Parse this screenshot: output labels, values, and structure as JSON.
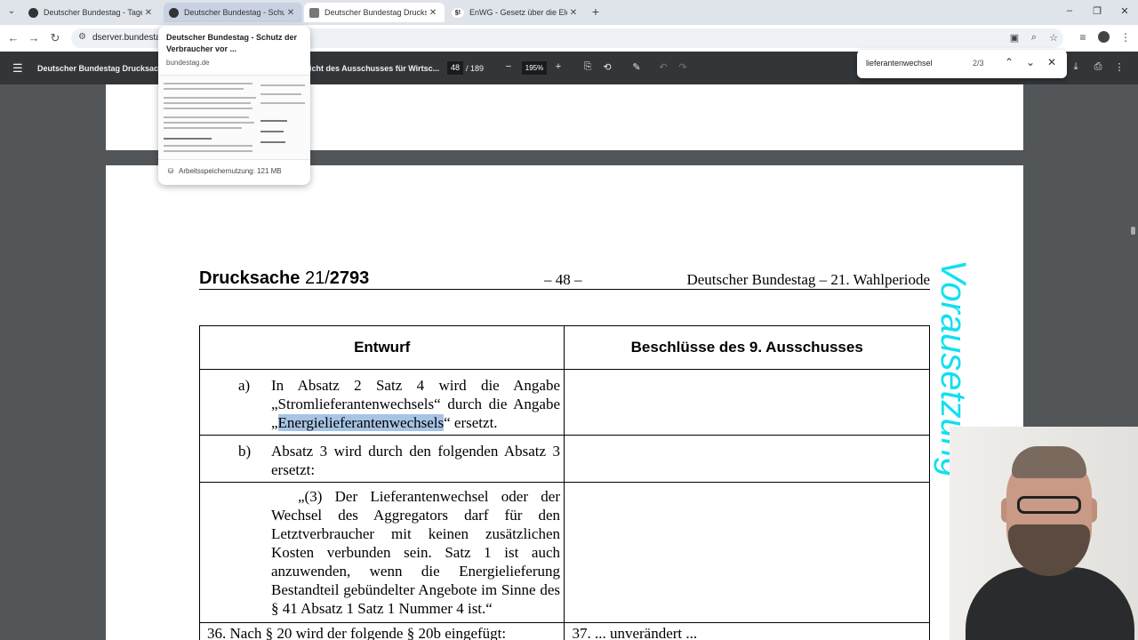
{
  "browser": {
    "tabs": [
      {
        "title": "Deutscher Bundestag - Tagesor"
      },
      {
        "title": "Deutscher Bundestag - Schutz d"
      },
      {
        "title": "Deutscher Bundestag Drucksac"
      },
      {
        "title": "EnWG - Gesetz über die Elektri"
      }
    ],
    "tab3_favicon": "§!",
    "url": "dserver.bundestag"
  },
  "hovercard": {
    "title": "Deutscher Bundestag - Schutz der Verbraucher vor ...",
    "domain": "bundestag.de",
    "memory": "Arbeitsspeichernutzung: 121 MB"
  },
  "pdf_toolbar": {
    "doc_title": "Deutscher Bundestag Drucksach",
    "doc_title_tail": "icht des Ausschusses für Wirtsc...",
    "page_current": "48",
    "page_total": "/ 189",
    "zoom": "195%"
  },
  "find": {
    "query": "lieferantenwechsel",
    "count": "2/3"
  },
  "document": {
    "header_left_prefix": "Drucksache",
    "header_left_num1": "21/",
    "header_left_num2": "2793",
    "header_center": "– 48 –",
    "header_right": "Deutscher Bundestag – 21. Wahlperiode",
    "col_left": "Entwurf",
    "col_right": "Beschlüsse des 9. Ausschusses",
    "row_a_label": "a)",
    "row_a_text_1": "In Absatz 2 Satz 4 wird die Angabe „Stromlieferantenwechsels“ durch die Angabe „",
    "row_a_highlight": "Energielieferantenwechsels",
    "row_a_text_2": "“ ersetzt.",
    "row_b_label": "b)",
    "row_b_text": "Absatz 3 wird durch den folgenden Absatz 3 ersetzt:",
    "row_c_text": "„(3) Der Lieferantenwechsel oder der Wechsel des Aggregators darf für den Letztverbraucher mit keinen zusätzlichen Kosten verbunden sein. Satz 1 ist auch anzuwenden, wenn die Energielieferung Bestandteil gebündelter Angebote im Sinne des § 41 Absatz 1 Satz 1 Nummer 4 ist.“",
    "row_d_left": "36. Nach § 20 wird der folgende § 20b eingefügt:",
    "row_d_right": "37. ... unverändert ..."
  },
  "overlay": {
    "side_text": "Vorausetzung"
  },
  "colors": {
    "find_highlight": "#a7c4e4",
    "overlay_text": "#10e0ef"
  }
}
